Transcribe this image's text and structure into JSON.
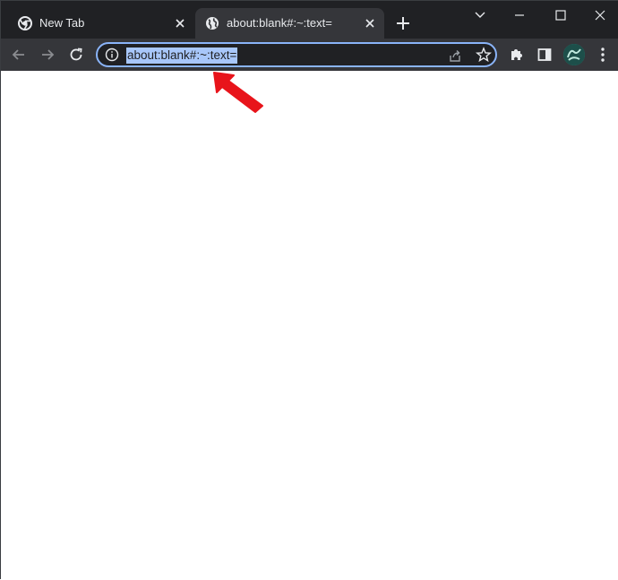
{
  "tabs": [
    {
      "label": "New Tab",
      "favicon": "chrome-icon"
    },
    {
      "label": "about:blank#:~:text=",
      "favicon": "globe-icon"
    }
  ],
  "omnibox": {
    "url": "about:blank#:~:text="
  },
  "colors": {
    "tabstrip": "#202124",
    "toolbar": "#35363a",
    "omnibox_border": "#8ab4f8",
    "selection": "#a8c7fa",
    "annotation_arrow": "#e8141b"
  }
}
